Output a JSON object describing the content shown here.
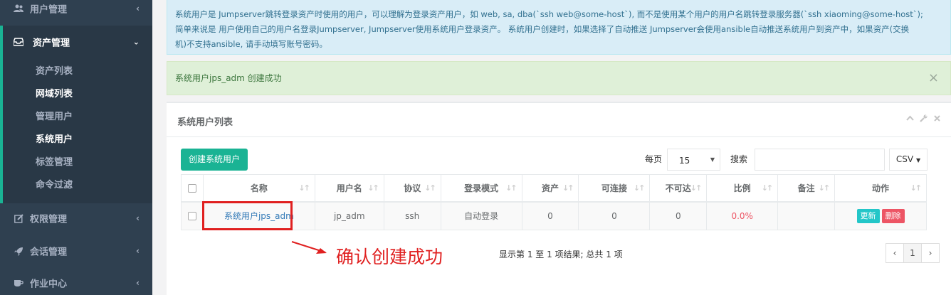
{
  "sidebar": {
    "items": [
      {
        "label": "用户管理",
        "icon": "users-icon"
      },
      {
        "label": "资产管理",
        "icon": "inbox-icon",
        "expanded": true
      },
      {
        "label": "权限管理",
        "icon": "edit-icon"
      },
      {
        "label": "会话管理",
        "icon": "rocket-icon"
      },
      {
        "label": "作业中心",
        "icon": "coffee-icon"
      }
    ],
    "subitems": [
      "资产列表",
      "网域列表",
      "管理用户",
      "系统用户",
      "标签管理",
      "命令过滤"
    ]
  },
  "info_alert": {
    "line1": "系统用户是 Jumpserver跳转登录资产时使用的用户，可以理解为登录资产用户，如 web, sa, dba(`ssh web@some-host`), 而不是使用某个用户的用户名跳转登录服务器(`ssh xiaoming@some-host`);",
    "line2": "简单来说是 用户使用自己的用户名登录Jumpserver, Jumpserver使用系统用户登录资产。 系统用户创建时，如果选择了自动推送 Jumpserver会使用ansible自动推送系统用户到资产中，如果资产(交换",
    "line3": "机)不支持ansible, 请手动填写账号密码。"
  },
  "success_alert": {
    "text": "系统用户jps_adm 创建成功",
    "close": "×"
  },
  "panel": {
    "title": "系统用户列表"
  },
  "toolbar": {
    "create_label": "创建系统用户",
    "per_page_label": "每页",
    "per_page_value": "15",
    "search_label": "搜索",
    "search_value": "",
    "csv_label": "CSV"
  },
  "table": {
    "headers": [
      "名称",
      "用户名",
      "协议",
      "登录模式",
      "资产",
      "可连接",
      "不可达",
      "比例",
      "备注",
      "动作"
    ],
    "rows": [
      {
        "name": "系统用户jps_adm",
        "username": "jp_adm",
        "protocol": "ssh",
        "login_mode": "自动登录",
        "assets": "0",
        "reachable": "0",
        "unreachable": "0",
        "ratio": "0.0%",
        "comment": "",
        "update_label": "更新",
        "delete_label": "删除"
      }
    ]
  },
  "footer": {
    "info": "显示第 1 至 1 项结果; 总共 1 项",
    "pages": [
      "‹",
      "1",
      "›"
    ]
  },
  "annotation": {
    "text": "确认创建成功",
    "color": "#e02020"
  },
  "colors": {
    "sidebar_bg": "#2f4050",
    "accent": "#1ab394",
    "danger": "#ed5565",
    "info": "#23c6c8"
  }
}
